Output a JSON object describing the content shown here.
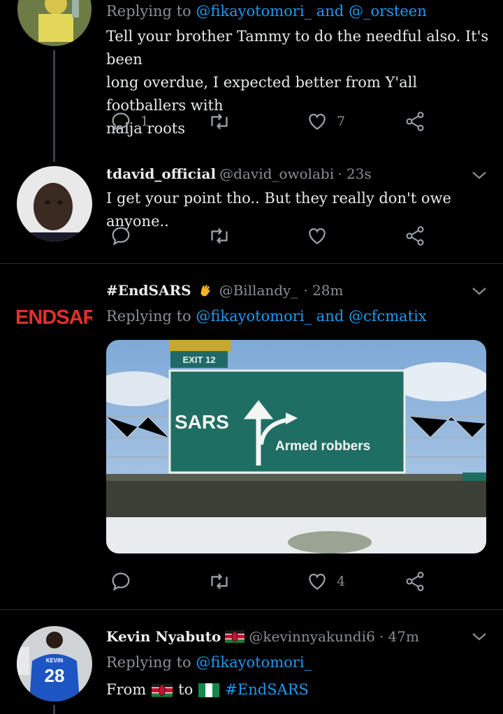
{
  "tweet1": {
    "replying_prefix": "Replying to",
    "reply_to_1": "@fikayotomori_",
    "and_word": "and",
    "reply_to_2": "@_orsteen",
    "text_line1": "Tell your brother Tammy to do the needful also. It's been",
    "text_line2": "long overdue, I expected better from Y'all footballers with",
    "text_line3": "naija roots",
    "reply_count": "1",
    "like_count": "7"
  },
  "tweet2": {
    "name": "tdavid_official",
    "handle": "@david_owolabi",
    "time": "· 23s",
    "text": "I get your point tho.. But they really don't owe anyone.."
  },
  "tweet3": {
    "name": "#EndSARS",
    "handle": "@Billandy_",
    "time": "· 28m",
    "avatar_text": "ENDSAR",
    "replying_prefix": "Replying to",
    "reply_to_1": "@fikayotomori_",
    "and_word": "and",
    "reply_to_2": "@cfcmatix",
    "image": {
      "exit_label": "EXIT 12",
      "sign_left": "SARS",
      "sign_right": "Armed robbers"
    },
    "like_count": "4"
  },
  "tweet4": {
    "name": "Kevin Nyabuto",
    "handle": "@kevinnyakundi6",
    "time": "· 47m",
    "jersey_name": "KEVIN",
    "jersey_number": "28",
    "replying_prefix": "Replying to",
    "reply_to_1": "@fikayotomori_",
    "text_from": "From",
    "text_to": "to",
    "hashtag": "#EndSARS"
  },
  "colors": {
    "link": "#1d9bf0",
    "background": "#000000",
    "muted": "#8b8f94"
  },
  "icons": [
    "reply-icon",
    "retweet-icon",
    "like-icon",
    "share-icon",
    "chevron-down-icon",
    "clap-icon",
    "kenya-flag-icon",
    "nigeria-flag-icon"
  ]
}
